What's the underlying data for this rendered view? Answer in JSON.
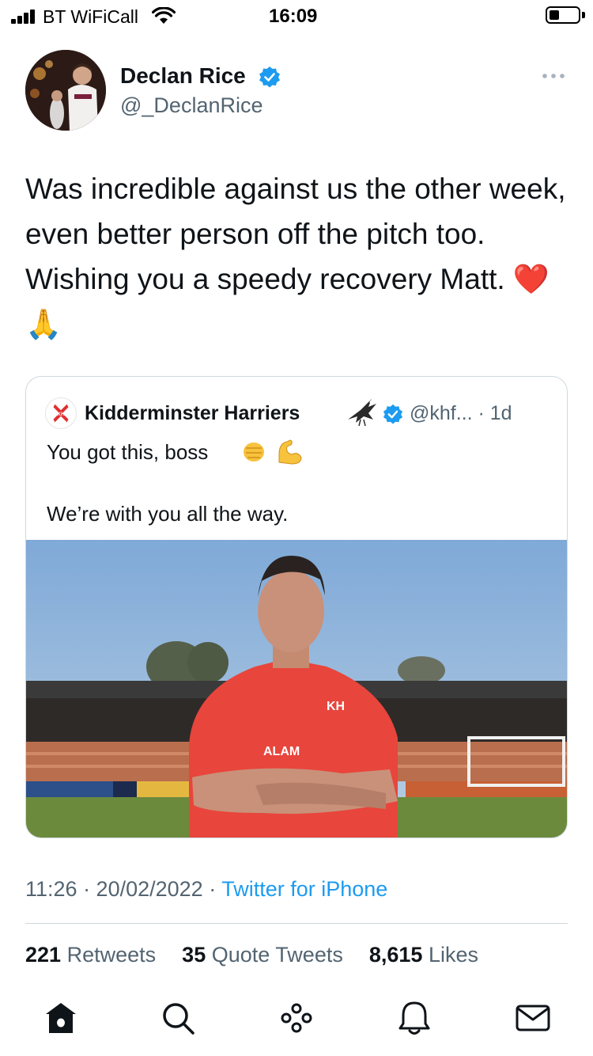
{
  "status_bar": {
    "carrier": "BT WiFiCall",
    "time": "16:09",
    "battery_level": 0.25
  },
  "author": {
    "name": "Declan Rice",
    "handle": "@_DeclanRice",
    "verified": true,
    "avatar_icon": "profile-photo"
  },
  "tweet": {
    "text": "Was incredible against us the other week, even better person off the pitch too. Wishing you a speedy recovery Matt. ❤️🙏"
  },
  "quote": {
    "name": "Kidderminster Harriers",
    "meta": "@khf... · 1d",
    "line1": "You got this, boss",
    "line2": "We’re with you all the way.",
    "photo_icon": "player-photo"
  },
  "timestamp": {
    "time_date": "11:26 · 20/02/2022 · ",
    "source": "Twitter for iPhone"
  },
  "stats": {
    "retweets_count": "221",
    "retweets_label": "Retweets",
    "quotes_count": "35",
    "quotes_label": "Quote Tweets",
    "likes_count": "8,615",
    "likes_label": "Likes"
  },
  "tabbar": [
    "home-icon",
    "search-icon",
    "spaces-icon",
    "notifications-icon",
    "messages-icon"
  ],
  "colors": {
    "accent": "#1d9bf0",
    "text": "#0f1419",
    "secondary": "#536471",
    "border": "#cfd9de"
  }
}
